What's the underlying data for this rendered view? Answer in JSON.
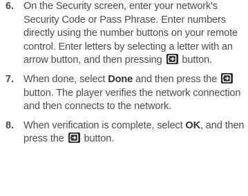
{
  "steps": [
    {
      "number": "6.",
      "text_a": "On the Security screen, enter your network's Security Code or Pass Phrase. Enter numbers directly using the number buttons on your remote control. Enter letters by selecting a letter with an arrow button, and then pressing",
      "text_b": " button."
    },
    {
      "number": "7.",
      "text_a": "When done, select ",
      "bold": "Done",
      "text_b": " and then press the ",
      "text_c": " button. The player verifies the network connection and then connects to the network."
    },
    {
      "number": "8.",
      "text_a": "When verification is complete, select ",
      "bold": "OK",
      "text_b": ", and then press the ",
      "text_c": " button."
    }
  ],
  "icons": {
    "enter": "enter-button-icon"
  }
}
